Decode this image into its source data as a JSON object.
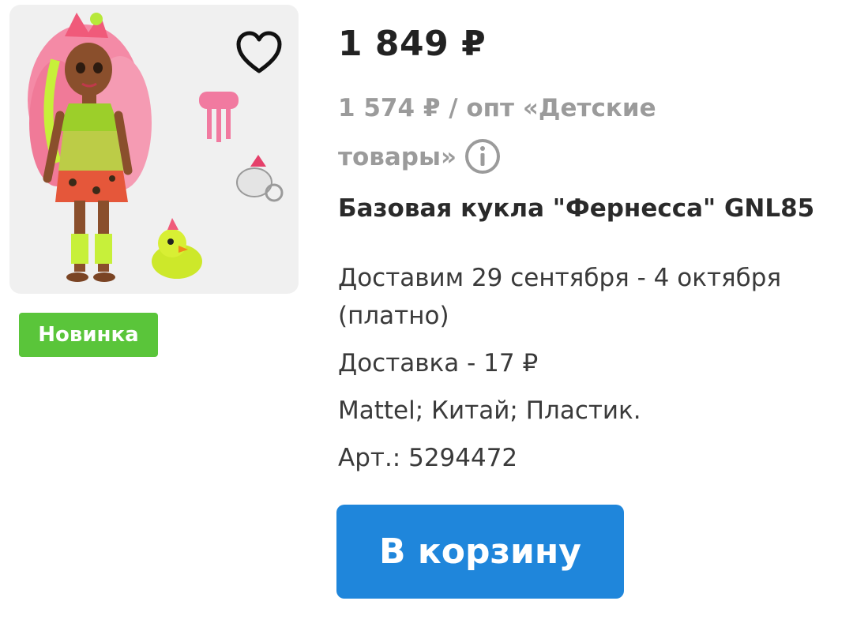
{
  "product": {
    "price": "1 849 ₽",
    "wholesale_price": "1 574 ₽ / опт «Детские товары»",
    "title": "Базовая кукла \"Фернесса\" GNL85",
    "delivery_dates": "Доставим 29 сентября - 4 октября (платно)",
    "delivery_cost": "Доставка - 17 ₽",
    "brand_info": "Mattel; Китай; Пластик.",
    "article": "Арт.: 5294472",
    "badge": "Новинка",
    "cart_button": "В корзину",
    "icons": {
      "favorite": "heart-outline-icon",
      "info": "info-circle-icon"
    }
  },
  "colors": {
    "badge_bg": "#5ac53a",
    "button_bg": "#1f86db",
    "muted_text": "#9b9b9b"
  }
}
